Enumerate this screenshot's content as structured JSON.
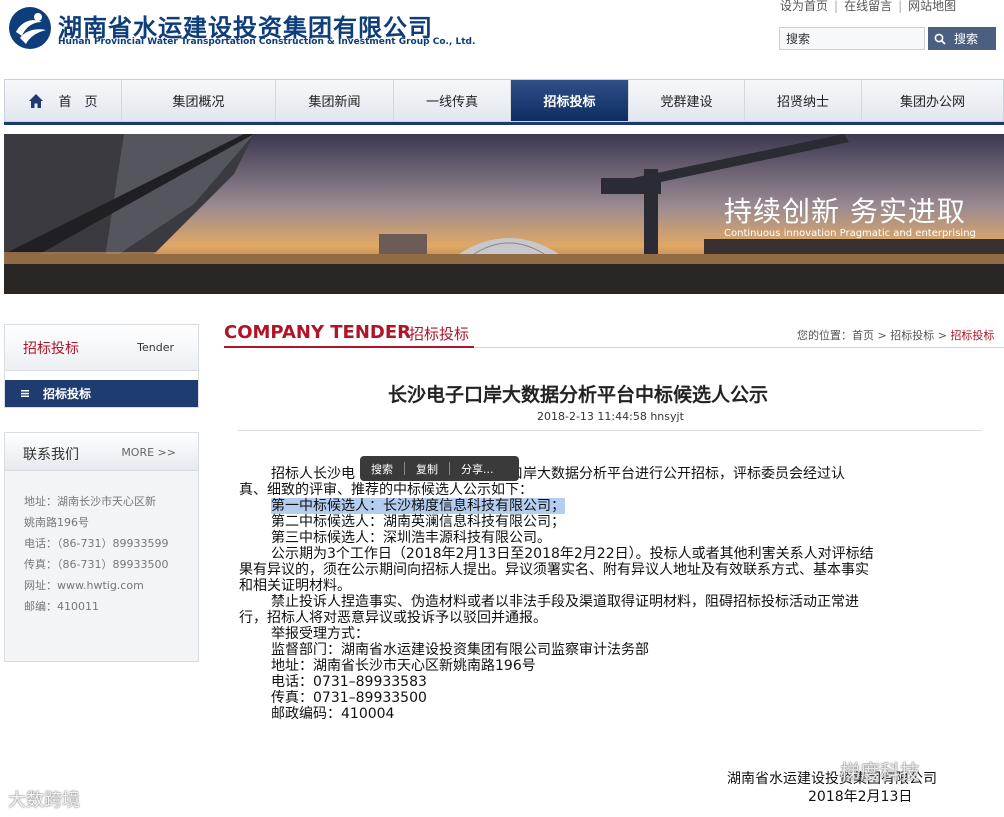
{
  "header": {
    "logo_cn": "湖南省水运建设投资集团有限公司",
    "logo_en": "Hunan Provincial Water Transportation Construction & Investment Group Co., Ltd.",
    "top_links": [
      "设为首页",
      "在线留言",
      "网站地图"
    ],
    "search_placeholder": "搜索",
    "search_button": "搜索"
  },
  "nav": {
    "items": [
      {
        "label": "首　页"
      },
      {
        "label": "集团概况"
      },
      {
        "label": "集团新闻"
      },
      {
        "label": "一线传真"
      },
      {
        "label": "招标投标"
      },
      {
        "label": "党群建设"
      },
      {
        "label": "招贤纳士"
      },
      {
        "label": "集团办公网"
      }
    ],
    "active_index": 4
  },
  "banner": {
    "slogan": "持续创新  务实进取",
    "slogan_en": "Continuous innovation Pragmatic and enterprising"
  },
  "sidebar": {
    "tender_title": "招标投标",
    "tender_en": "Tender",
    "menu_item": "招标投标",
    "contact_title": "联系我们",
    "contact_more": "MORE >>",
    "contact_lines": [
      "地址：湖南长沙市天心区新",
      "姚南路196号",
      "电话：（86-731）89933599",
      "传真：（86-731）89933500",
      "网址：www.hwtig.com",
      "邮编：410011"
    ]
  },
  "main": {
    "section_en": "COMPANY TENDER",
    "section_cn": "招标投标",
    "breadcrumb_prefix": "您的位置：",
    "breadcrumb": [
      "首页",
      "招标投标",
      "招标投标"
    ],
    "article_title": "长沙电子口岸大数据分析平台中标候选人公示",
    "article_meta": "2018-2-13 11:44:58  hnsyjt",
    "body": {
      "l1_a": "招标人长沙电",
      "l1_b": "沙电子口岸大数据分析平台进行公开招标，评标委员会经过认",
      "l2": "真、细致的评审、推荐的中标候选人公示如下：",
      "l3": "第一中标候选人：长沙梯度信息科技有限公司；",
      "l4": "第二中标候选人：湖南英澜信息科技有限公司；",
      "l5": "第三中标候选人：深圳浩丰源科技有限公司。",
      "l6": "公示期为3个工作日（2018年2月13日至2018年2月22日）。投标人或者其他利害关系人对评标结",
      "l7": "果有异议的，须在公示期间向招标人提出。异议须署实名、附有异议人地址及有效联系方式、基本事实",
      "l8": "和相关证明材料。",
      "l9": "禁止投诉人捏造事实、伪造材料或者以非法手段及渠道取得证明材料，阻碍招标投标活动正常进",
      "l10": "行，招标人将对恶意异议或投诉予以驳回并通报。",
      "l11": "举报受理方式：",
      "l12": "监督部门：湖南省水运建设投资集团有限公司监察审计法务部",
      "l13": "地址：湖南省长沙市天心区新姚南路196号",
      "l14": "电话：0731–89933583",
      "l15": "传真：0731–89933500",
      "l16": "邮政编码：410004"
    },
    "sign_org": "湖南省水运建设投资集团有限公司",
    "sign_date": "2018年2月13日"
  },
  "popup": {
    "items": [
      "搜索",
      "复制",
      "分享..."
    ]
  },
  "watermarks": {
    "right": "梯度科技",
    "left": "大数跨境"
  },
  "colors": {
    "brand_blue": "#0d3d7a",
    "nav_active": "#1e3c70",
    "accent_red": "#b01428"
  }
}
